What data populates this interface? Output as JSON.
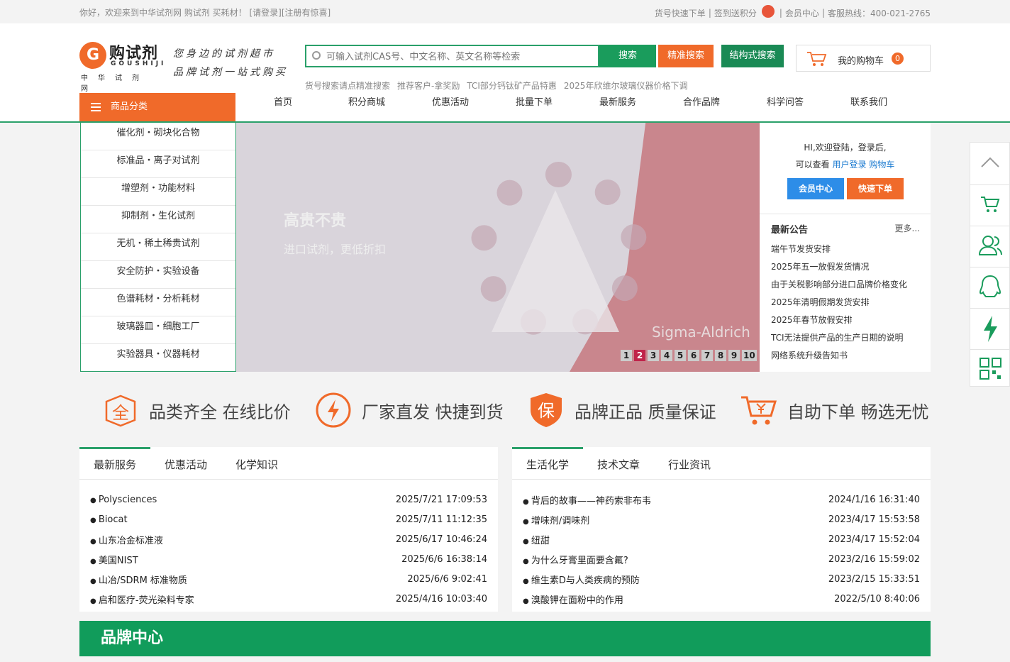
{
  "topbar": {
    "welcome": "你好，欢迎来到中华试剂网 购试剂 买耗材！",
    "login": "[请登录]",
    "register": "[注册有惊喜]",
    "quick_order": "货号快速下单",
    "sign_points": "签到送积分",
    "member": "会员中心",
    "hotline": "客服热线：400-021-2765"
  },
  "logo": {
    "mark": "G",
    "name": "购试剂",
    "pinyin": "GOUSHIJI",
    "sub": "中华试剂网"
  },
  "slogan": {
    "line1": "您身边的试剂超市",
    "line2": "品牌试剂一站式购买"
  },
  "search": {
    "placeholder": "可输入试剂CAS号、中文名称、英文名称等检索",
    "search_btn": "搜索",
    "precise_btn": "精准搜索",
    "structure_btn": "结构式搜索",
    "hotwords": [
      "货号搜索请点精准搜索",
      "推荐客户-拿奖励",
      "TCI部分钙钛矿产品特惠",
      "2025年欣维尔玻璃仪器价格下调"
    ]
  },
  "cart": {
    "label": "我的购物车",
    "count": "0"
  },
  "category_btn": "商品分类",
  "nav": [
    "首页",
    "积分商城",
    "优惠活动",
    "批量下单",
    "最新服务",
    "合作品牌",
    "科学问答",
    "联系我们"
  ],
  "categories": [
    "催化剂・砌块化合物",
    "标准品・离子对试剂",
    "增塑剂・功能材料",
    "抑制剂・生化试剂",
    "无机・稀土稀贵试剂",
    "安全防护・实验设备",
    "色谱耗材・分析耗材",
    "玻璃器皿・细胞工厂",
    "实验器具・仪器耗材"
  ],
  "banner": {
    "title": "高贵不贵",
    "subtitle": "进口试剂，更低折扣",
    "brand": "Sigma-Aldrich",
    "pages": [
      "1",
      "2",
      "3",
      "4",
      "5",
      "6",
      "7",
      "8",
      "9",
      "10"
    ],
    "active_page": 2
  },
  "side": {
    "greet1": "HI,欢迎登陆，登录后,",
    "greet2": "可以查看",
    "user_login": "用户登录",
    "cart_link": "购物车",
    "member_btn": "会员中心",
    "quick_btn": "快速下单",
    "notice_title": "最新公告",
    "more": "更多...",
    "notices": [
      "端午节发货安排",
      "2025年五一放假发货情况",
      "由于关税影响部分进口品牌价格变化",
      "2025年清明假期发货安排",
      "2025年春节放假安排",
      "TCI无法提供产品的生产日期的说明",
      "网络系统升级告知书"
    ]
  },
  "features": [
    "品类齐全 在线比价",
    "厂家直发 快捷到货",
    "品牌正品 质量保证",
    "自助下单 畅选无忧"
  ],
  "feature_glyphs": [
    "全",
    "保"
  ],
  "news_left": {
    "tabs": [
      "最新服务",
      "优惠活动",
      "化学知识"
    ],
    "rows": [
      {
        "title": "Polysciences",
        "time": "2025/7/21 17:09:53"
      },
      {
        "title": "Biocat",
        "time": "2025/7/11 11:12:35"
      },
      {
        "title": "山东冶金标准液",
        "time": "2025/6/17 10:46:24"
      },
      {
        "title": "美国NIST",
        "time": "2025/6/6 16:38:14"
      },
      {
        "title": "山冶/SDRM 标准物质",
        "time": "2025/6/6 9:02:41"
      },
      {
        "title": "启和医疗-荧光染料专家",
        "time": "2025/4/16 10:03:40"
      }
    ]
  },
  "news_right": {
    "tabs": [
      "生活化学",
      "技术文章",
      "行业资讯"
    ],
    "rows": [
      {
        "title": "背后的故事——神药索非布韦",
        "time": "2024/1/16 16:31:40"
      },
      {
        "title": "增味剂/调味剂",
        "time": "2023/4/17 15:53:58"
      },
      {
        "title": "纽甜",
        "time": "2023/4/17 15:52:04"
      },
      {
        "title": "为什么牙膏里面要含氟?",
        "time": "2023/2/16 15:59:02"
      },
      {
        "title": "维生素D与人类疾病的预防",
        "time": "2023/2/15 15:33:51"
      },
      {
        "title": "溴酸钾在面粉中的作用",
        "time": "2022/5/10 8:40:06"
      }
    ]
  },
  "brand_title": "品牌中心",
  "colors": {
    "green": "#2aa06a",
    "orange": "#f06a2a",
    "blue": "#2d8de8"
  }
}
